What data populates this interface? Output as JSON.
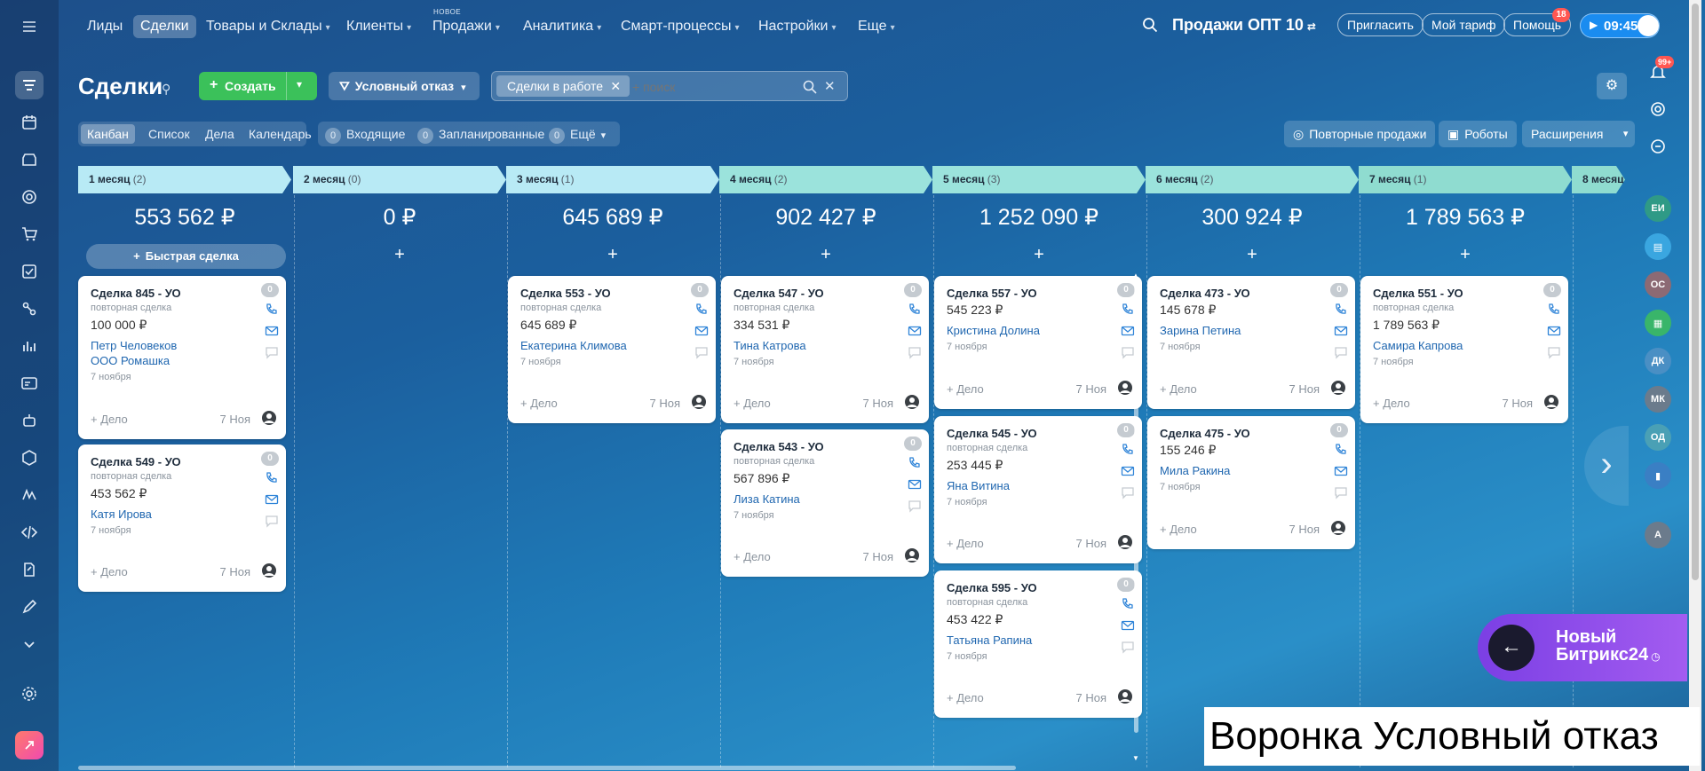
{
  "nav": {
    "items": [
      {
        "label": "Лиды",
        "chev": false
      },
      {
        "label": "Сделки",
        "chev": false
      },
      {
        "label": "Товары и Склады",
        "chev": true
      },
      {
        "label": "Клиенты",
        "chev": true
      },
      {
        "label": "Продажи",
        "chev": true
      },
      {
        "label": "Аналитика",
        "chev": true
      },
      {
        "label": "Смарт-процессы",
        "chev": true
      },
      {
        "label": "Настройки",
        "chev": true
      },
      {
        "label": "Еще",
        "chev": true
      }
    ],
    "new_badge": "НОВОЕ",
    "portal": "Продажи ОПТ 10",
    "invite": "Пригласить",
    "tariff": "Мой тариф",
    "help": "Помощь",
    "help_count": "18",
    "time": "09:45"
  },
  "header": {
    "title": "Сделки",
    "create": "Создать",
    "filter": "Условный отказ",
    "chip": "Сделки в работе",
    "search_placeholder": "+ поиск"
  },
  "views": {
    "tabs": [
      "Канбан",
      "Список",
      "Дела",
      "Календарь"
    ],
    "counters": [
      {
        "num": "0",
        "label": "Входящие"
      },
      {
        "num": "0",
        "label": "Запланированные"
      },
      {
        "num": "0",
        "label": "Ещё"
      }
    ],
    "repeat": "Повторные продажи",
    "robots": "Роботы",
    "ext": "Расширения"
  },
  "notif_count": "99+",
  "quick_deal": "Быстрая сделка",
  "columns": [
    {
      "name": "1 месяц",
      "count": "(2)",
      "sum": "553 562 ₽",
      "color": "#b8eaf5"
    },
    {
      "name": "2 месяц",
      "count": "(0)",
      "sum": "0 ₽",
      "color": "#b8eaf5"
    },
    {
      "name": "3 месяц",
      "count": "(1)",
      "sum": "645 689 ₽",
      "color": "#b8eaf5"
    },
    {
      "name": "4 месяц",
      "count": "(2)",
      "sum": "902 427 ₽",
      "color": "#9be3dc"
    },
    {
      "name": "5 месяц",
      "count": "(3)",
      "sum": "1 252 090 ₽",
      "color": "#9be3dc"
    },
    {
      "name": "6 месяц",
      "count": "(2)",
      "sum": "300 924 ₽",
      "color": "#9be3dc"
    },
    {
      "name": "7 месяц",
      "count": "(1)",
      "sum": "1 789 563 ₽",
      "color": "#8fdcd0"
    },
    {
      "name": "8 месяц",
      "count": "",
      "sum": "",
      "color": "#8fdcd0"
    }
  ],
  "cards": [
    {
      "title": "Сделка 845 - УО",
      "sub": "повторная сделка",
      "price": "100 000 ₽",
      "contact": "Петр Человеков",
      "company": "ООО Ромашка",
      "date": "7 ноября",
      "badge": "0",
      "task": "+ Дело",
      "short": "7 Ноя"
    },
    {
      "title": "Сделка 549 - УО",
      "sub": "повторная сделка",
      "price": "453 562 ₽",
      "contact": "Катя Ирова",
      "company": "",
      "date": "7 ноября",
      "badge": "0",
      "task": "+ Дело",
      "short": "7 Ноя"
    },
    {
      "title": "Сделка 553 - УО",
      "sub": "повторная сделка",
      "price": "645 689 ₽",
      "contact": "Екатерина Климова",
      "company": "",
      "date": "7 ноября",
      "badge": "0",
      "task": "+ Дело",
      "short": "7 Ноя"
    },
    {
      "title": "Сделка 547 - УО",
      "sub": "повторная сделка",
      "price": "334 531 ₽",
      "contact": "Тина Катрова",
      "company": "",
      "date": "7 ноября",
      "badge": "0",
      "task": "+ Дело",
      "short": "7 Ноя"
    },
    {
      "title": "Сделка 543 - УО",
      "sub": "повторная сделка",
      "price": "567 896 ₽",
      "contact": "Лиза Катина",
      "company": "",
      "date": "7 ноября",
      "badge": "0",
      "task": "+ Дело",
      "short": "7 Ноя"
    },
    {
      "title": "Сделка 557 - УО",
      "sub": "",
      "price": "545 223 ₽",
      "contact": "Кристина Долина",
      "company": "",
      "date": "7 ноября",
      "badge": "0",
      "task": "+ Дело",
      "short": "7 Ноя"
    },
    {
      "title": "Сделка 545 - УО",
      "sub": "повторная сделка",
      "price": "253 445 ₽",
      "contact": "Яна Витина",
      "company": "",
      "date": "7 ноября",
      "badge": "0",
      "task": "+ Дело",
      "short": "7 Ноя"
    },
    {
      "title": "Сделка 595 - УО",
      "sub": "повторная сделка",
      "price": "453 422 ₽",
      "contact": "Татьяна Рапина",
      "company": "",
      "date": "7 ноября",
      "badge": "0",
      "task": "+ Дело",
      "short": "7 Ноя"
    },
    {
      "title": "Сделка 473 - УО",
      "sub": "",
      "price": "145 678 ₽",
      "contact": "Зарина Петина",
      "company": "",
      "date": "7 ноября",
      "badge": "0",
      "task": "+ Дело",
      "short": "7 Ноя"
    },
    {
      "title": "Сделка 475 - УО",
      "sub": "",
      "price": "155 246 ₽",
      "contact": "Мила Ракина",
      "company": "",
      "date": "7 ноября",
      "badge": "0",
      "task": "+ Дело",
      "short": "7 Ноя"
    },
    {
      "title": "Сделка 551 - УО",
      "sub": "повторная сделка",
      "price": "1 789 563 ₽",
      "contact": "Самира Капрова",
      "company": "",
      "date": "7 ноября",
      "badge": "0",
      "task": "+ Дело",
      "short": "7 Ноя"
    }
  ],
  "right_rail": [
    "ЕИ",
    "",
    "ОС",
    "",
    "ДК",
    "МК",
    "ОД",
    "",
    "А"
  ],
  "promo": {
    "line1": "Новый",
    "line2": "Битрикс24"
  },
  "caption": "Воронка Условный отказ"
}
